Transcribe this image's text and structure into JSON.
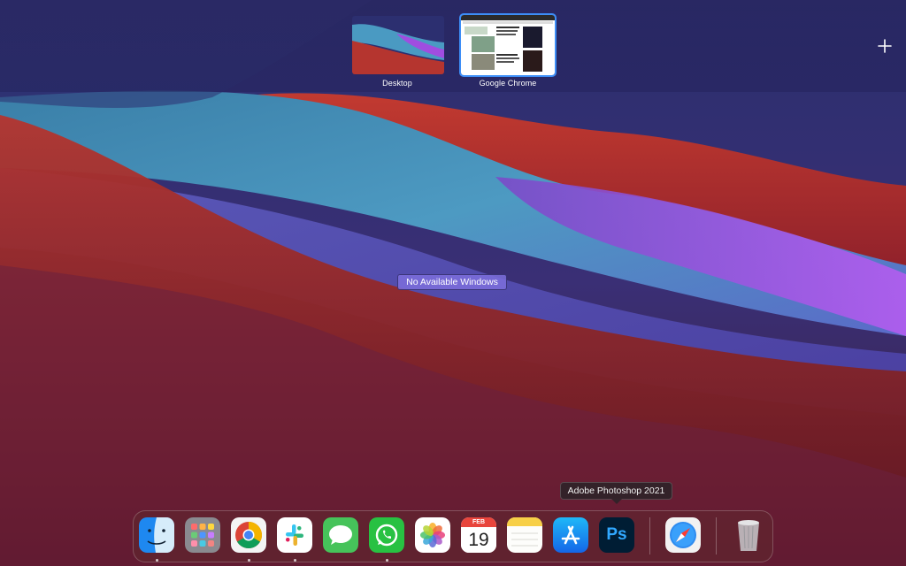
{
  "spaces": {
    "items": [
      {
        "label": "Desktop"
      },
      {
        "label": "Google Chrome"
      }
    ],
    "add_space_icon": "plus-icon"
  },
  "center_label": "No Available Windows",
  "dock": {
    "tooltip": "Adobe Photoshop 2021",
    "items": [
      {
        "name": "Finder",
        "icon": "finder-icon",
        "running": true
      },
      {
        "name": "Launchpad",
        "icon": "launchpad-icon",
        "running": false
      },
      {
        "name": "Google Chrome",
        "icon": "chrome-icon",
        "running": true
      },
      {
        "name": "Slack",
        "icon": "slack-icon",
        "running": true
      },
      {
        "name": "Messages",
        "icon": "messages-icon",
        "running": false
      },
      {
        "name": "WhatsApp",
        "icon": "whatsapp-icon",
        "running": true
      },
      {
        "name": "Photos",
        "icon": "photos-icon",
        "running": false
      },
      {
        "name": "Calendar",
        "icon": "calendar-icon",
        "running": false,
        "month": "FEB",
        "day": "19"
      },
      {
        "name": "Notes",
        "icon": "notes-icon",
        "running": false
      },
      {
        "name": "App Store",
        "icon": "app-store-icon",
        "running": false
      },
      {
        "name": "Adobe Photoshop 2021",
        "icon": "photoshop-icon",
        "running": false,
        "text": "Ps"
      },
      {
        "name": "Safari",
        "icon": "safari-icon",
        "running": false
      },
      {
        "name": "Trash",
        "icon": "trash-icon",
        "running": false
      }
    ]
  },
  "colors": {
    "accent": "#3d8ef7",
    "wallpaper_red": "#c0392b",
    "wallpaper_blue": "#4a8fc0",
    "wallpaper_purple": "#a04de0"
  }
}
